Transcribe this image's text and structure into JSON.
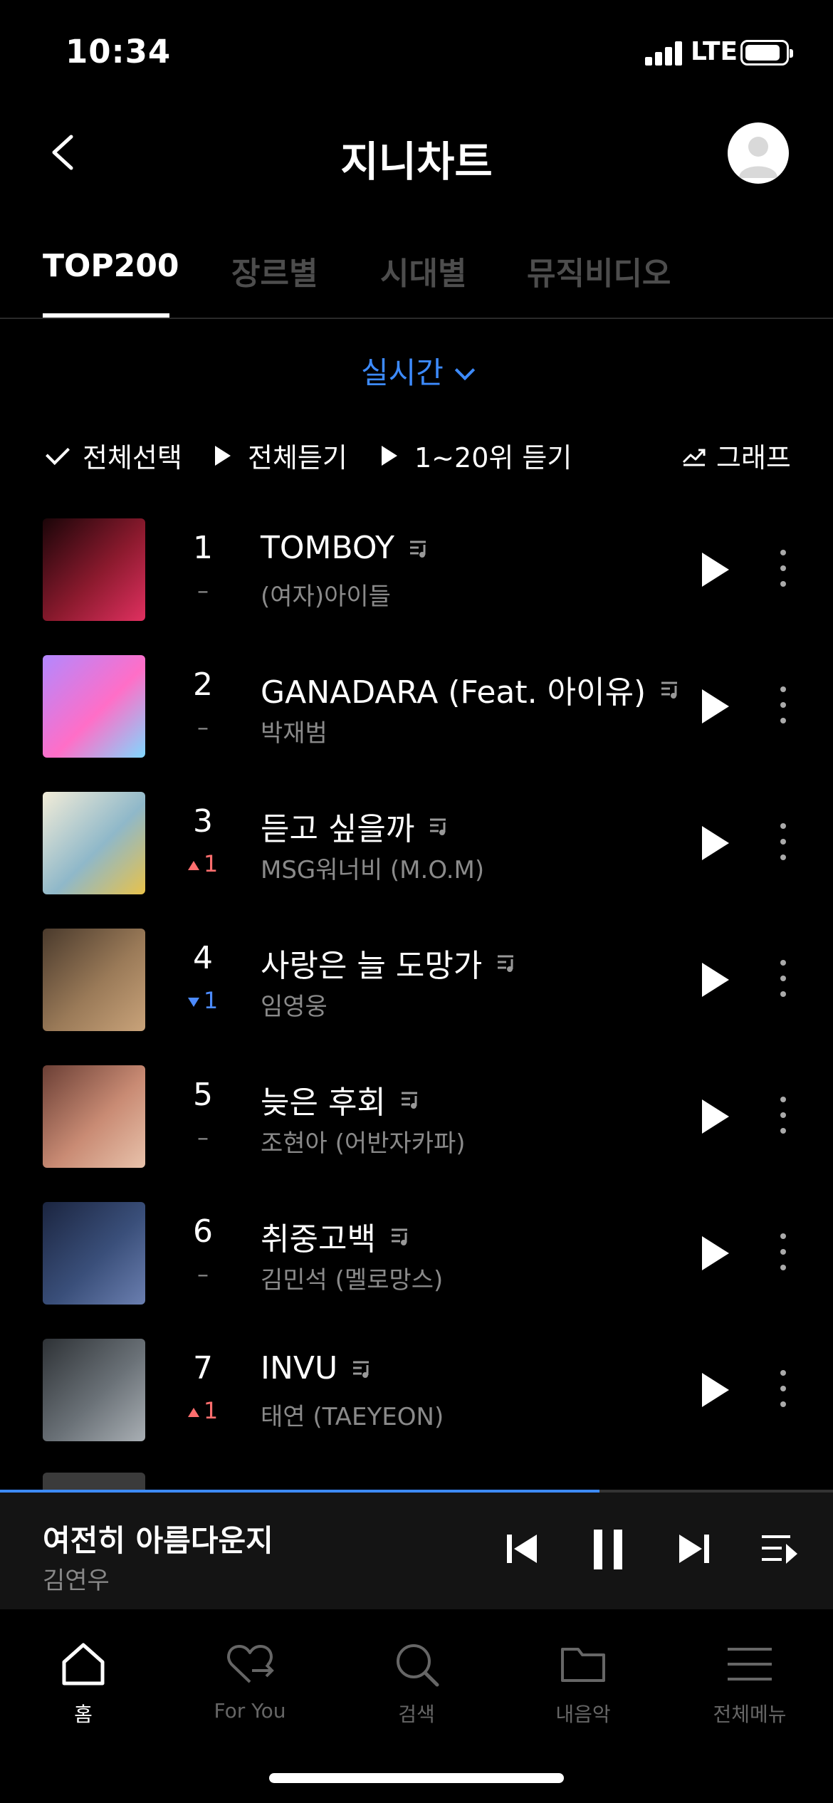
{
  "status_bar": {
    "time": "10:34",
    "network": "LTE"
  },
  "header": {
    "title": "지니차트"
  },
  "tabs": [
    {
      "label": "TOP200",
      "active": true
    },
    {
      "label": "장르별",
      "active": false
    },
    {
      "label": "시대별",
      "active": false
    },
    {
      "label": "뮤직비디오",
      "active": false
    }
  ],
  "period": {
    "label": "실시간"
  },
  "actions": {
    "select_all": "전체선택",
    "play_all": "전체듣기",
    "play_top20": "1~20위 듣기",
    "graph": "그래프"
  },
  "chart": [
    {
      "rank": "1",
      "change": "–",
      "change_dir": "same",
      "title": "TOMBOY",
      "artist": "(여자)아이들",
      "art_colors": [
        "#1a0508",
        "#8c1a2e",
        "#e03060"
      ]
    },
    {
      "rank": "2",
      "change": "–",
      "change_dir": "same",
      "title": "GANADARA (Feat. 아이유)",
      "artist": "박재범",
      "art_colors": [
        "#b388ff",
        "#ff6ec7",
        "#7fd8ff"
      ]
    },
    {
      "rank": "3",
      "change": "1",
      "change_dir": "up",
      "title": "듣고 싶을까",
      "artist": "MSG워너비 (M.O.M)",
      "art_colors": [
        "#f2ecd8",
        "#8fb8c9",
        "#e8c24a"
      ]
    },
    {
      "rank": "4",
      "change": "1",
      "change_dir": "down",
      "title": "사랑은 늘 도망가",
      "artist": "임영웅",
      "art_colors": [
        "#4a3a2c",
        "#9a7a58",
        "#c9a37a"
      ]
    },
    {
      "rank": "5",
      "change": "–",
      "change_dir": "same",
      "title": "늦은 후회",
      "artist": "조현아 (어반자카파)",
      "art_colors": [
        "#6b3f35",
        "#c98b74",
        "#e8c2ab"
      ]
    },
    {
      "rank": "6",
      "change": "–",
      "change_dir": "same",
      "title": "취중고백",
      "artist": "김민석 (멜로망스)",
      "art_colors": [
        "#1b2540",
        "#3a4f7a",
        "#6b7fb0"
      ]
    },
    {
      "rank": "7",
      "change": "1",
      "change_dir": "up",
      "title": "INVU",
      "artist": "태연 (TAEYEON)",
      "art_colors": [
        "#2e3236",
        "#6a7177",
        "#a9afb4"
      ]
    }
  ],
  "now_playing": {
    "title": "여전히 아름다운지",
    "artist": "김연우",
    "progress": 0.72
  },
  "nav": [
    {
      "label": "홈",
      "icon": "home-icon",
      "active": true
    },
    {
      "label": "For You",
      "icon": "heart-arrow-icon",
      "active": false
    },
    {
      "label": "검색",
      "icon": "search-icon",
      "active": false
    },
    {
      "label": "내음악",
      "icon": "folder-icon",
      "active": false
    },
    {
      "label": "전체메뉴",
      "icon": "menu-icon",
      "active": false
    }
  ],
  "colors": {
    "accent": "#3d8bff",
    "up": "#ff6e6e",
    "down": "#4c8bff",
    "background": "#000000"
  }
}
